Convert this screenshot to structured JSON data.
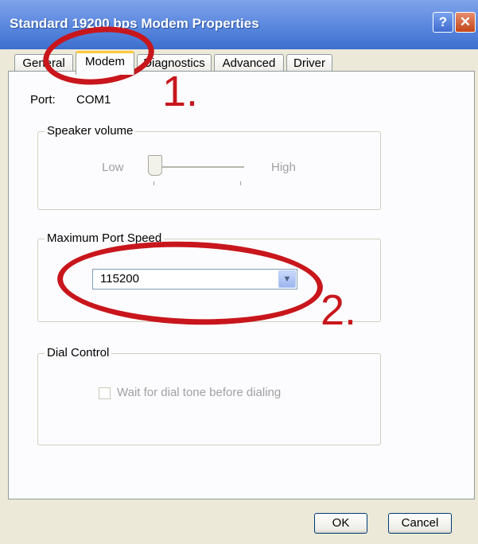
{
  "window": {
    "title": "Standard 19200 bps Modem Properties",
    "help_label": "?",
    "close_label": "✕"
  },
  "tabs": [
    {
      "label": "General",
      "active": false
    },
    {
      "label": "Modem",
      "active": true
    },
    {
      "label": "Diagnostics",
      "active": false
    },
    {
      "label": "Advanced",
      "active": false
    },
    {
      "label": "Driver",
      "active": false
    }
  ],
  "port": {
    "label": "Port:",
    "value": "COM1"
  },
  "speaker_volume": {
    "group_label": "Speaker volume",
    "low_label": "Low",
    "high_label": "High",
    "level": 0.0,
    "enabled": false
  },
  "max_port_speed": {
    "group_label": "Maximum Port Speed",
    "selected": "115200"
  },
  "dial_control": {
    "group_label": "Dial Control",
    "checkbox_label": "Wait for dial tone before dialing",
    "checked": false,
    "enabled": false
  },
  "buttons": {
    "ok": "OK",
    "cancel": "Cancel"
  },
  "annotations": {
    "step1": "1.",
    "step2": "2.",
    "color": "#c8161c"
  },
  "colors": {
    "title_bar": "#4f7fd9",
    "active_tab_accent": "#ffc83c",
    "dialog_bg": "#ece9d8"
  }
}
